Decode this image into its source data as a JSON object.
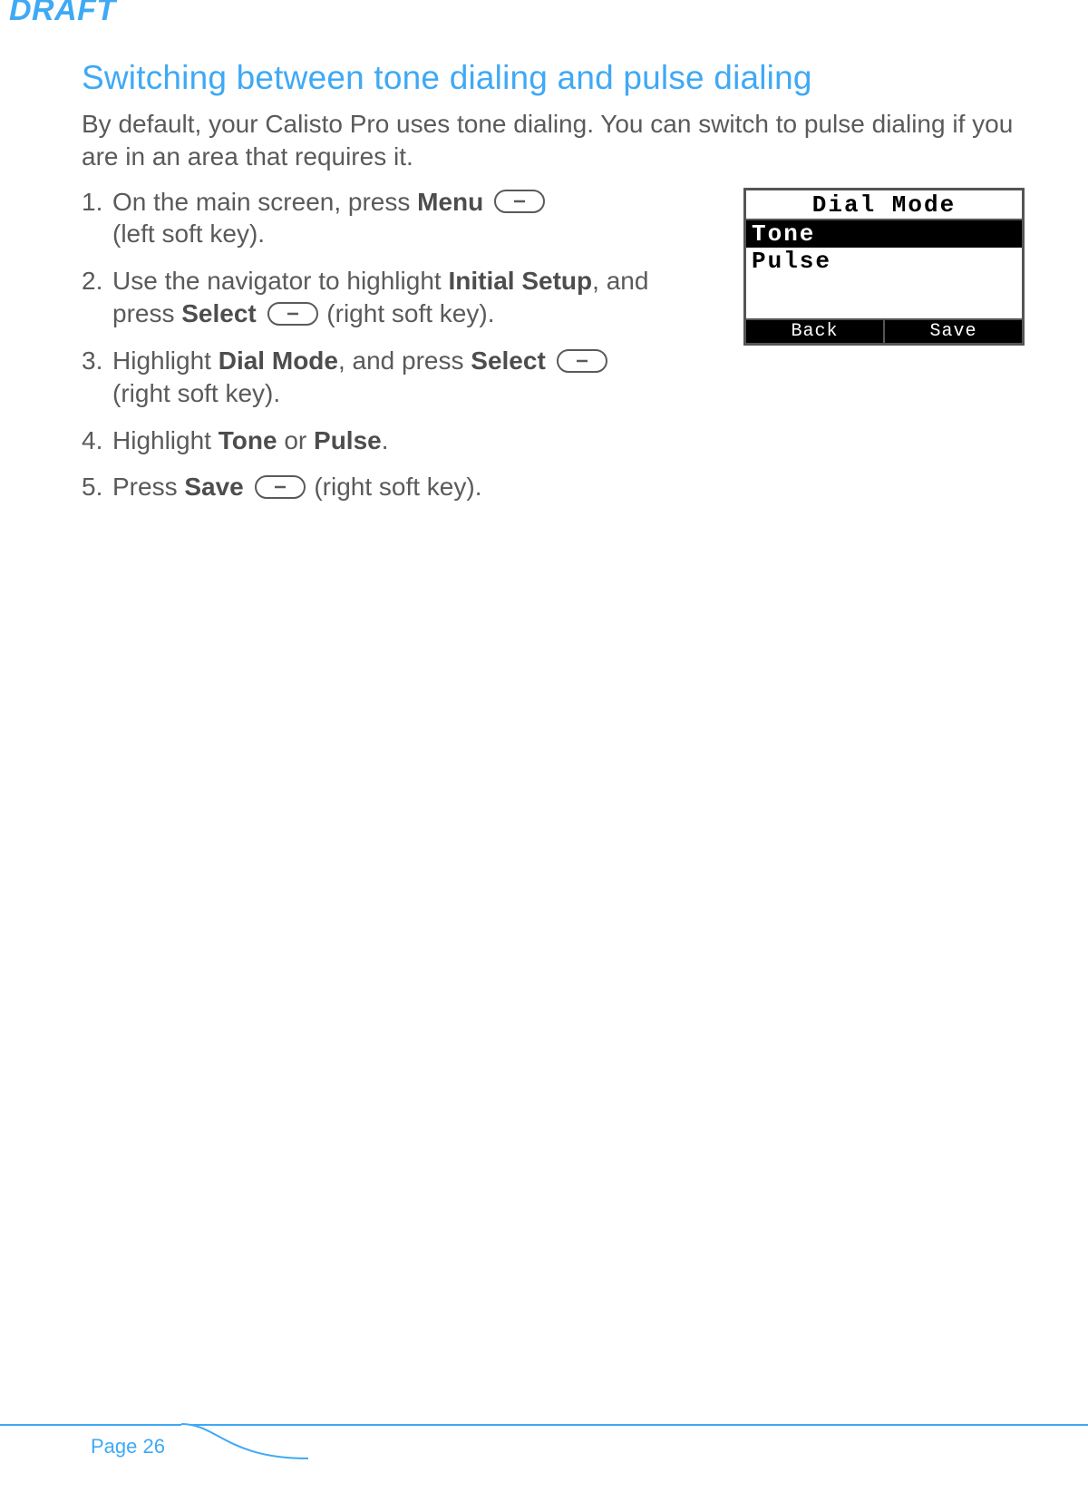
{
  "watermark": "DRAFT",
  "title": "Switching between tone dialing and pulse dialing",
  "intro": "By default, your Calisto Pro uses tone dialing. You can switch to pulse dialing if you are in an area that requires it.",
  "steps": {
    "s1": {
      "pre": "On the main screen, press ",
      "bold1": "Menu",
      "post": " (left soft key)."
    },
    "s2": {
      "pre": "Use the navigator to highlight ",
      "bold1": "Initial Setup",
      "mid": ", and press ",
      "bold2": "Select",
      "post": " (right soft key)."
    },
    "s3": {
      "pre": "Highlight ",
      "bold1": "Dial Mode",
      "mid": ", and press ",
      "bold2": "Select",
      "post": " (right soft key)."
    },
    "s4": {
      "pre": "Highlight ",
      "bold1": "Tone",
      "mid": " or ",
      "bold2": "Pulse",
      "post": "."
    },
    "s5": {
      "pre": "Press ",
      "bold1": "Save",
      "post": " (right soft key)."
    }
  },
  "phone": {
    "title": "Dial Mode",
    "item1": "Tone",
    "item2": "Pulse",
    "softleft": "Back",
    "softright": "Save"
  },
  "footer": {
    "page": "Page 26"
  }
}
